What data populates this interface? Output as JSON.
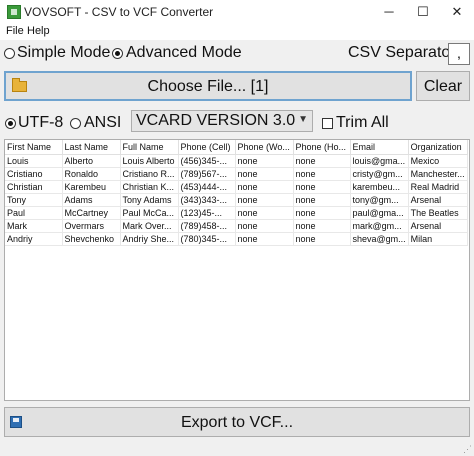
{
  "window": {
    "title": "VOVSOFT - CSV to VCF Converter",
    "minimize": "─",
    "maximize": "☐",
    "close": "✕"
  },
  "menu": {
    "items": [
      "File",
      "Help"
    ]
  },
  "mode": {
    "simple_label": "Simple Mode",
    "advanced_label": "Advanced Mode",
    "selected": "advanced"
  },
  "csv_separator": {
    "label": "CSV Separator:",
    "value": ","
  },
  "buttons": {
    "choose_file": "Choose File... [1]",
    "clear": "Clear",
    "export": "Export to VCF..."
  },
  "encoding": {
    "utf8_label": "UTF-8",
    "ansi_label": "ANSI",
    "selected": "utf8"
  },
  "vcard_version": {
    "selected": "VCARD VERSION 3.0"
  },
  "trim_all": {
    "label": "Trim All",
    "checked": false
  },
  "table": {
    "columns": [
      "First Name",
      "Last Name",
      "Full Name",
      "Phone (Cell)",
      "Phone (Wo...",
      "Phone (Ho...",
      "Email",
      "Organization"
    ],
    "rows": [
      [
        "Louis",
        "Alberto",
        "Louis Alberto",
        "(456)345-...",
        "none",
        "none",
        "louis@gma...",
        "Mexico"
      ],
      [
        "Cristiano",
        "Ronaldo",
        "Cristiano R...",
        "(789)567-...",
        "none",
        "none",
        "cristy@gm...",
        "Manchester..."
      ],
      [
        "Christian",
        "Karembeu",
        "Christian K...",
        "(453)444-...",
        "none",
        "none",
        "karembeu...",
        "Real Madrid"
      ],
      [
        "Tony",
        "Adams",
        "Tony Adams",
        "(343)343-...",
        "none",
        "none",
        "tony@gm...",
        "Arsenal"
      ],
      [
        "Paul",
        "McCartney",
        "Paul McCa...",
        "(123)45-...",
        "none",
        "none",
        "paul@gma...",
        "The Beatles"
      ],
      [
        "Mark",
        "Overmars",
        "Mark Over...",
        "(789)458-...",
        "none",
        "none",
        "mark@gm...",
        "Arsenal"
      ],
      [
        "Andriy",
        "Shevchenko",
        "Andriy She...",
        "(780)345-...",
        "none",
        "none",
        "sheva@gm...",
        "Milan"
      ]
    ]
  },
  "icons": {
    "app": "app-icon",
    "folder": "folder-icon",
    "save": "save-icon",
    "dropdown": "chevron-down-icon"
  },
  "colors": {
    "choose_button_border": "#6fa3cf",
    "window_bg": "#f0f0f0"
  }
}
